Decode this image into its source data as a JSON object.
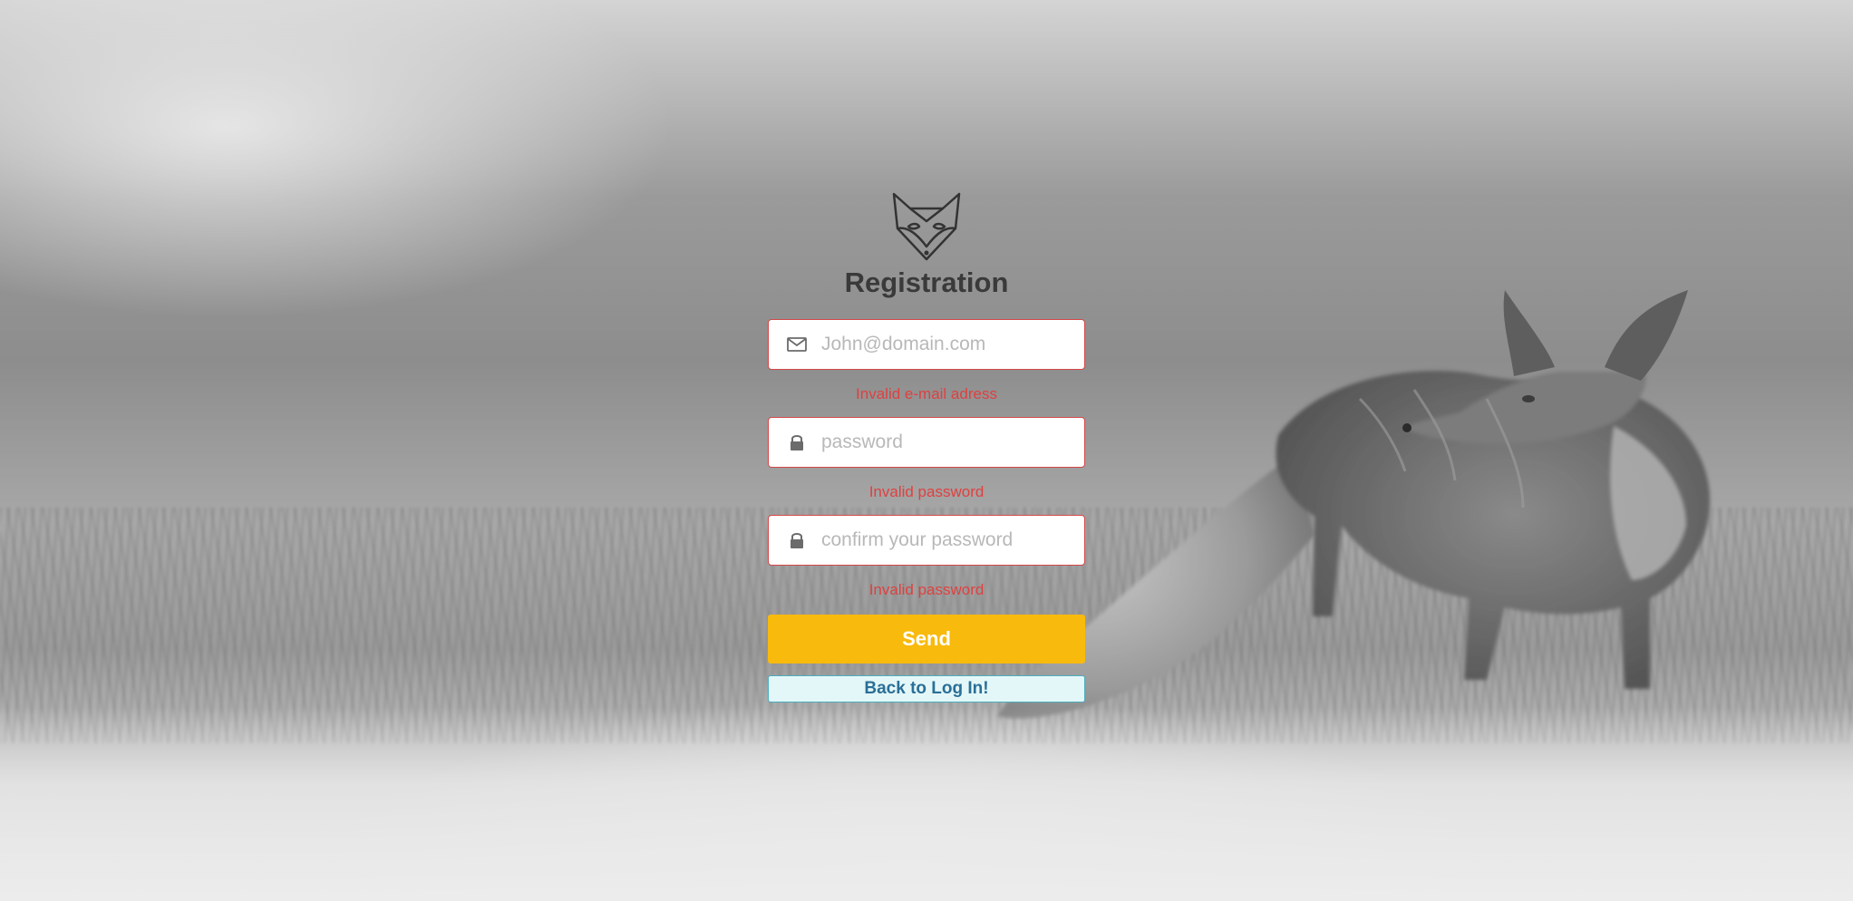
{
  "page": {
    "title": "Registration"
  },
  "form": {
    "email": {
      "icon": "envelope-icon",
      "value": "",
      "placeholder": "John@domain.com",
      "error": "Invalid e-mail adress"
    },
    "password": {
      "icon": "lock-icon",
      "value": "",
      "placeholder": "password",
      "error": "Invalid password"
    },
    "confirm_password": {
      "icon": "lock-icon",
      "value": "",
      "placeholder": "confirm your password",
      "error": "Invalid password"
    },
    "send_label": "Send",
    "back_label": "Back to Log In!"
  },
  "colors": {
    "accent": "#f8ba0c",
    "error": "#e04040",
    "field_border": "#d34848",
    "back_button_bg": "#e4f7f8",
    "back_button_border": "#4aaec0",
    "back_button_text": "#2a6f97",
    "title": "#3a3a3a"
  }
}
